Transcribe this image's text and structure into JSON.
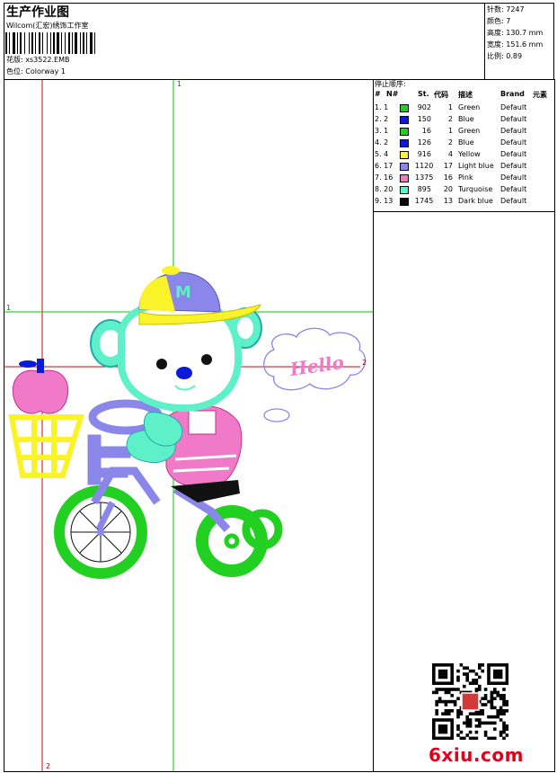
{
  "header": {
    "title": "生产作业图",
    "subtitle": "Wilcom(汇宏)绣饰工作室",
    "design_file": "花版: xs3522.EMB",
    "colorway": "色位: Colorway 1"
  },
  "stats": {
    "stitches": "针数: 7247",
    "colors": "颜色: 7",
    "height": "高度: 130.7 mm",
    "width": "宽度: 151.6 mm",
    "ratio": "比例: 0.89"
  },
  "legend": {
    "title": "停止顺序:",
    "headers": [
      "#",
      "N#",
      "St.",
      "代码",
      "描述",
      "Brand",
      "元素"
    ],
    "rows": [
      {
        "idx": "1. 1",
        "st": "902",
        "code": "1",
        "desc": "Green",
        "brand": "Default",
        "color": "#21d020"
      },
      {
        "idx": "2. 2",
        "st": "150",
        "code": "2",
        "desc": "Blue",
        "brand": "Default",
        "color": "#0a1ad8"
      },
      {
        "idx": "3. 1",
        "st": "16",
        "code": "1",
        "desc": "Green",
        "brand": "Default",
        "color": "#21d020"
      },
      {
        "idx": "4. 2",
        "st": "126",
        "code": "2",
        "desc": "Blue",
        "brand": "Default",
        "color": "#0a1ad8"
      },
      {
        "idx": "5. 4",
        "st": "916",
        "code": "4",
        "desc": "Yellow",
        "brand": "Default",
        "color": "#fbf32a"
      },
      {
        "idx": "6. 17",
        "st": "1120",
        "code": "17",
        "desc": "Light blue",
        "brand": "Default",
        "color": "#8a86ea"
      },
      {
        "idx": "7. 16",
        "st": "1375",
        "code": "16",
        "desc": "Pink",
        "brand": "Default",
        "color": "#f07ac8"
      },
      {
        "idx": "8. 20",
        "st": "895",
        "code": "20",
        "desc": "Turquoise",
        "brand": "Default",
        "color": "#5ef0c8"
      },
      {
        "idx": "9. 13",
        "st": "1745",
        "code": "13",
        "desc": "Dark blue",
        "brand": "Default",
        "color": "#0a0a0a"
      }
    ]
  },
  "canvas": {
    "marker_v_green_top": "1",
    "marker_h_green_left": "1",
    "marker_h_red_right": "2",
    "marker_v_red_bottom": "2",
    "cloud_text": "Hello"
  },
  "watermark": "6xiu.com",
  "colors": {
    "green": "#21d020",
    "yellow": "#fbf32a",
    "light_blue": "#8a86ea",
    "pink": "#f07ac8",
    "turquoise": "#5ef0c8",
    "guide_red": "#e00000",
    "guide_green": "#00c800"
  }
}
